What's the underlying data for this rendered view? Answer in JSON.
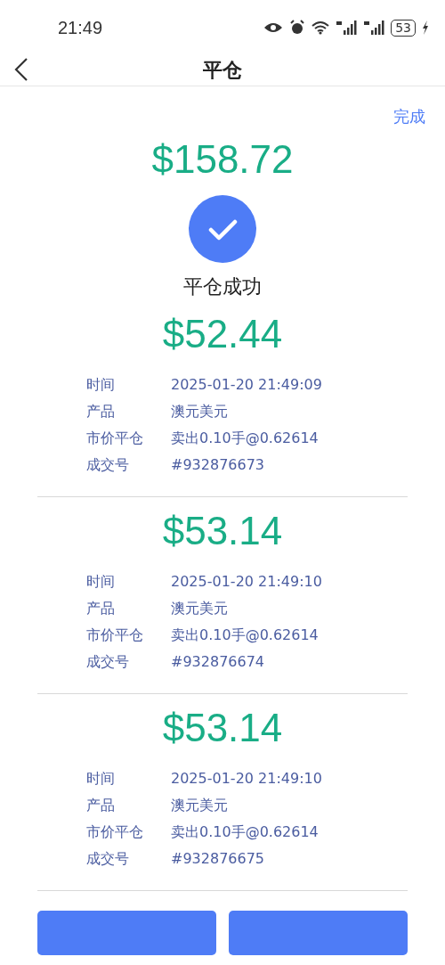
{
  "status_bar": {
    "time": "21:49",
    "battery": "53"
  },
  "header": {
    "title": "平仓"
  },
  "done_link": "完成",
  "total": "$158.72",
  "result": "平仓成功",
  "trades": [
    {
      "amount": "$52.44",
      "rows": [
        {
          "label": "时间",
          "value": "2025-01-20 21:49:09"
        },
        {
          "label": "产品",
          "value": "澳元美元"
        },
        {
          "label": "市价平仓",
          "value": "卖出0.10手@0.62614"
        },
        {
          "label": "成交号",
          "value": "#932876673"
        }
      ]
    },
    {
      "amount": "$53.14",
      "rows": [
        {
          "label": "时间",
          "value": "2025-01-20 21:49:10"
        },
        {
          "label": "产品",
          "value": "澳元美元"
        },
        {
          "label": "市价平仓",
          "value": "卖出0.10手@0.62614"
        },
        {
          "label": "成交号",
          "value": "#932876674"
        }
      ]
    },
    {
      "amount": "$53.14",
      "rows": [
        {
          "label": "时间",
          "value": "2025-01-20 21:49:10"
        },
        {
          "label": "产品",
          "value": "澳元美元"
        },
        {
          "label": "市价平仓",
          "value": "卖出0.10手@0.62614"
        },
        {
          "label": "成交号",
          "value": "#932876675"
        }
      ]
    }
  ],
  "buttons": [
    {
      "kind": "primary"
    },
    {
      "kind": "primary"
    }
  ]
}
